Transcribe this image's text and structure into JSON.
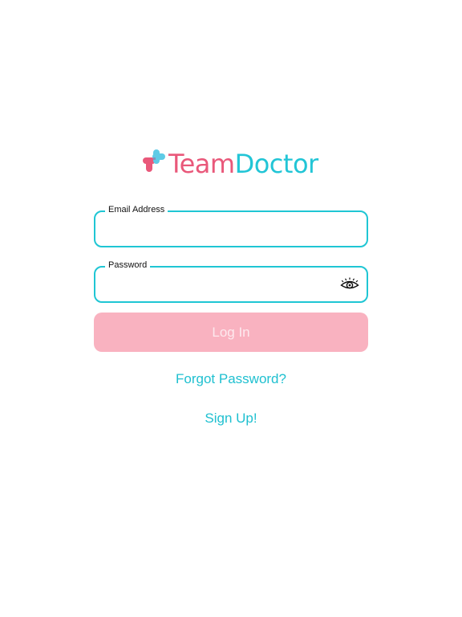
{
  "app": {
    "name_part1": "Team",
    "name_part2": "Doctor",
    "brand_pink": "#e9587a",
    "brand_cyan": "#22c5d6",
    "logo_icon": "medical-cross-icon"
  },
  "form": {
    "email": {
      "label": "Email Address",
      "value": "",
      "placeholder": ""
    },
    "password": {
      "label": "Password",
      "value": "",
      "placeholder": "",
      "toggle_icon": "eye-icon"
    },
    "login_label": "Log In",
    "login_color": "#f9b2c0"
  },
  "links": {
    "forgot_password": "Forgot Password?",
    "sign_up": "Sign Up!"
  }
}
